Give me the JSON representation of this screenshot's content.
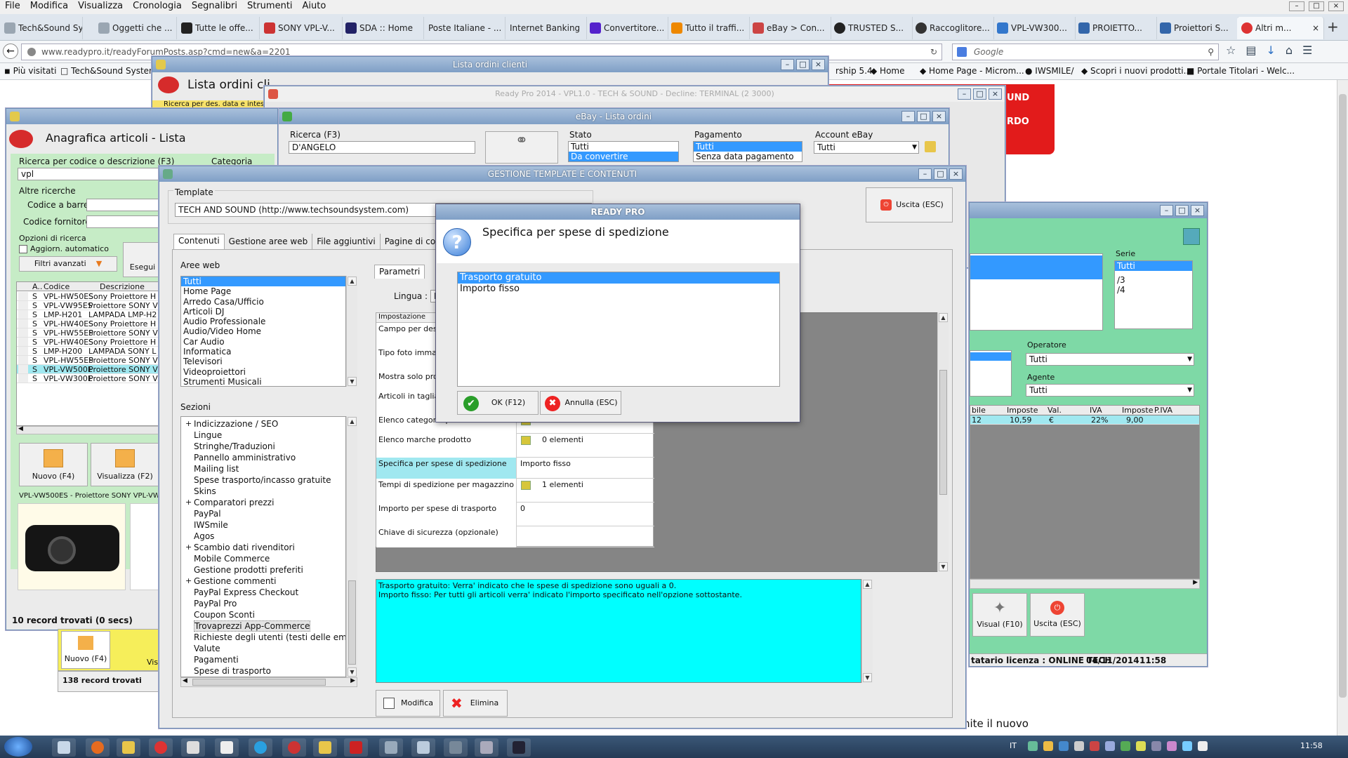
{
  "browser": {
    "menu": [
      "File",
      "Modifica",
      "Visualizza",
      "Cronologia",
      "Segnalibri",
      "Strumenti",
      "Aiuto"
    ],
    "tabs": [
      "Tech&Sound Sy...",
      "Oggetti che ...",
      "Tutte le offe...",
      "SONY VPL-V...",
      "SDA :: Home",
      "Poste Italiane - ...",
      "Internet Banking",
      "Convertitore...",
      "Tutto il traffi...",
      "eBay > Con...",
      "TRUSTED S...",
      "Raccoglitore...",
      "VPL-VW300...",
      "PROIETTO...",
      "Proiettori S...",
      "Altri m..."
    ],
    "url": "www.readypro.it/readyForumPosts.asp?cmd=new&a=2201",
    "search_placeholder": "Google",
    "bookmarks": [
      "Più visitati",
      "Tech&Sound System",
      "rship 5.4",
      "Home",
      "Home Page - Microm...",
      "IWSMILE/",
      "Scopri i nuovi prodotti...",
      "Portale Titolari - Welc..."
    ],
    "page_red_text1": "UND",
    "page_red_text2": "RDO",
    "page_footer_text": "nite il nuovo"
  },
  "ordini_clienti": {
    "title": "Lista ordini clienti",
    "heading": "Lista ordini cli",
    "search_hint": "Ricerca per des. data e intes..."
  },
  "ebay": {
    "title": "eBay - Lista ordini",
    "behind_title": "Ready Pro 2014 - VPL1.0 - TECH & SOUND - Decline: TERMINAL (2 3000)",
    "ricerca_label": "Ricerca (F3)",
    "ricerca_value": "D'ANGELO",
    "stato_label": "Stato",
    "stato_items": [
      "Tutti",
      "Da convertire"
    ],
    "pagamento_label": "Pagamento",
    "pagamento_items": [
      "Tutti",
      "Senza data pagamento"
    ],
    "account_label": "Account eBay",
    "account_value": "Tutti"
  },
  "anagrafica": {
    "title_bar": "",
    "heading": "Anagrafica articoli  - Lista",
    "ricerca_label": "Ricerca per codice o descrizione (F3)",
    "ricerca_value": "vpl",
    "categoria_label": "Categoria",
    "altre_label": "Altre ricerche",
    "barcode_label": "Codice a barre :",
    "fornitore_label": "Codice fornitore :",
    "opzioni_label": "Opzioni di ricerca",
    "aggiorn_label": "Aggiorn. automatico",
    "filtri_label": "Filtri avanzati",
    "esegui_label": "Esegui",
    "columns": [
      "A...",
      "Codice",
      "Descrizione"
    ],
    "rows": [
      [
        "S",
        "VPL-HW50ES",
        "Sony Proiettore H"
      ],
      [
        "S",
        "VPL-VW95ES",
        "Proiettore SONY V"
      ],
      [
        "S",
        "LMP-H201",
        "LAMPADA LMP-H2"
      ],
      [
        "S",
        "VPL-HW40ES...",
        "Sony Proiettore H"
      ],
      [
        "S",
        "VPL-HW55ES",
        "Proiettore SONY V"
      ],
      [
        "S",
        "VPL-HW40ES",
        "Sony Proiettore H"
      ],
      [
        "S",
        "LMP-H200",
        "LAMPADA SONY L"
      ],
      [
        "S",
        "VPL-HW55ES...",
        "Proiettore SONY V"
      ],
      [
        "S",
        "VPL-VW500ES",
        "Proiettore SONY V"
      ],
      [
        "S",
        "VPL-VW300ES",
        "Proiettore SONY V"
      ]
    ],
    "nuovo_label": "Nuovo (F4)",
    "visualizza_label": "Visualizza (F2)",
    "preview_caption": "VPL-VW500ES - Proiettore SONY VPL-VW5",
    "status": "10 record trovati (0 secs)",
    "behind_nuovo": "Nuovo (F4)",
    "behind_visu": "Visu",
    "behind_status": "138 record trovati"
  },
  "right_panel": {
    "serie_label": "Serie",
    "serie_items": [
      "Tutti",
      "/3",
      "/4"
    ],
    "operatore_label": "Operatore",
    "operatore_value": "Tutti",
    "agente_label": "Agente",
    "agente_value": "Tutti",
    "columns": [
      "bile",
      "Imposte",
      "Val.",
      "IVA",
      "Imposte",
      "P.IVA"
    ],
    "row": [
      "12",
      "10,59",
      "€",
      "22%",
      "9,00",
      ""
    ],
    "visual_label": "Visual (F10)",
    "uscita_label": "Uscita (ESC)",
    "footer_license": "tatario licenza : ONLINE TECH",
    "footer_date": "04/11/2014",
    "footer_time": "11:58"
  },
  "gestione": {
    "title": "GESTIONE TEMPLATE E CONTENUTI",
    "template_label": "Template",
    "template_value": "TECH AND SOUND (http://www.techsoundsystem.com)",
    "uscita_label": "Uscita (ESC)",
    "tabs": [
      "Contenuti",
      "Gestione aree web",
      "File aggiuntivi",
      "Pagine di contenu"
    ],
    "aree_label": "Aree web",
    "aree_items": [
      "Tutti",
      "Home Page",
      "Arredo Casa/Ufficio",
      "Articoli DJ",
      "Audio Professionale",
      "Audio/Video Home",
      "Car Audio",
      "Informatica",
      "Televisori",
      "Videoproiettori",
      "Strumenti Musicali"
    ],
    "sezioni_label": "Sezioni",
    "sezioni_items": [
      {
        "t": "Indicizzazione / SEO",
        "exp": "+"
      },
      {
        "t": "Lingue",
        "exp": ""
      },
      {
        "t": "Stringhe/Traduzioni",
        "exp": ""
      },
      {
        "t": "Pannello amministrativo",
        "exp": ""
      },
      {
        "t": "Mailing list",
        "exp": ""
      },
      {
        "t": "Spese trasporto/incasso gratuite",
        "exp": ""
      },
      {
        "t": "Skins",
        "exp": ""
      },
      {
        "t": "Comparatori prezzi",
        "exp": "+"
      },
      {
        "t": "PayPal",
        "exp": ""
      },
      {
        "t": "IWSmile",
        "exp": ""
      },
      {
        "t": "Agos",
        "exp": ""
      },
      {
        "t": "Scambio dati rivenditori",
        "exp": "+"
      },
      {
        "t": "Mobile Commerce",
        "exp": ""
      },
      {
        "t": "Gestione prodotti preferiti",
        "exp": ""
      },
      {
        "t": "Gestione commenti",
        "exp": "+"
      },
      {
        "t": "PayPal Express Checkout",
        "exp": ""
      },
      {
        "t": "PayPal Pro",
        "exp": ""
      },
      {
        "t": "Coupon Sconti",
        "exp": ""
      },
      {
        "t": "Trovaprezzi App-Commerce",
        "exp": ""
      },
      {
        "t": "Richieste degli utenti (testi delle ema",
        "exp": ""
      },
      {
        "t": "Valute",
        "exp": ""
      },
      {
        "t": "Pagamenti",
        "exp": ""
      },
      {
        "t": "Spese di trasporto",
        "exp": ""
      }
    ],
    "parametri_tab": "Parametri",
    "lingua_label": "Lingua :",
    "lingua_value": "I",
    "impostazione_header": "Impostazione",
    "params": [
      {
        "k": "Campo per descri",
        "v": "",
        "icon": false
      },
      {
        "k": "Tipo foto immagin",
        "v": "",
        "icon": false
      },
      {
        "k": "Mostra solo prod magazzino",
        "v": "",
        "icon": false
      },
      {
        "k": "Articoli in taglia/co",
        "v": "",
        "icon": false
      },
      {
        "k": "Elenco categorie prodotto",
        "v": "3 elementi",
        "icon": true
      },
      {
        "k": "Elenco marche prodotto",
        "v": "0 elementi",
        "icon": true
      },
      {
        "k": "Specifica per spese di spedizione",
        "v": "Importo fisso",
        "icon": false,
        "hl": true
      },
      {
        "k": "Tempi di spedizione per magazzino",
        "v": "1 elementi",
        "icon": true
      },
      {
        "k": "Importo per spese di trasporto",
        "v": "0",
        "icon": false
      },
      {
        "k": "Chiave di sicurezza (opzionale)",
        "v": "",
        "icon": false
      }
    ],
    "help_text": [
      "Trasporto gratuito: Verra' indicato che le spese di spedizione sono uguali a 0.",
      "Importo fisso: Per tutti gli articoli verra' indicato l'importo specificato nell'opzione sottostante."
    ],
    "modifica_label": "Modifica",
    "elimina_label": "Elimina"
  },
  "dialog": {
    "title": "READY PRO",
    "question": "Specifica per spese di spedizione",
    "options": [
      "Trasporto gratuito",
      "Importo fisso"
    ],
    "ok_label": "OK (F12)",
    "annulla_label": "Annulla (ESC)"
  },
  "taskbar": {
    "lang": "IT",
    "time": "11:58"
  },
  "colors": {
    "title_bar": "#8aa7cb",
    "selection": "#3399ff",
    "help_bg": "#00ffff",
    "highlight_row": "#a0e8f0",
    "green_panel": "#7ed9a6",
    "brand_red": "#e21b1b"
  }
}
